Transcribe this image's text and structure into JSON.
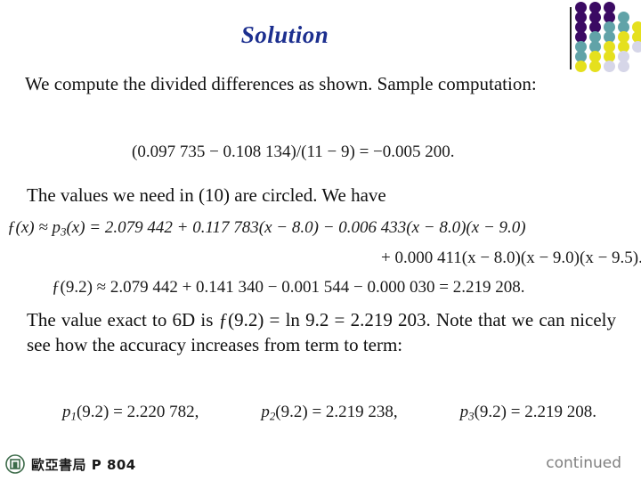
{
  "slide": {
    "title": "Solution",
    "title_color": "#1c2f8f"
  },
  "paragraphs": {
    "p1": "We compute the divided differences as shown. Sample computation:",
    "p2": "The values we need in (10) are circled. We have",
    "p3": "The value exact to 6D is ƒ(9.2) = ln 9.2 = 2.219 203. Note that we can nicely see how the accuracy increases from term to term:"
  },
  "equations": {
    "sample_computation": "(0.097 735 − 0.108 134)/(11 − 9) = −0.005 200.",
    "poly_line1_lhs": "ƒ(x) ≈ p",
    "poly_line1_sub": "3",
    "poly_line1_rhs": "(x) = 2.079 442 + 0.117 783(x − 8.0) − 0.006 433(x − 8.0)(x − 9.0)",
    "poly_line2": "+ 0.000 411(x − 8.0)(x − 9.0)(x − 9.5).",
    "evaluation": "ƒ(9.2) ≈ 2.079 442 + 0.141 340 − 0.001 544 − 0.000 030 = 2.219 208.",
    "terms": [
      {
        "symbol": "p",
        "sub": "1",
        "arg": "(9.2)",
        "rel": " = ",
        "value": "2.220 782,"
      },
      {
        "symbol": "p",
        "sub": "2",
        "arg": "(9.2)",
        "rel": " = ",
        "value": "2.219 238,"
      },
      {
        "symbol": "p",
        "sub": "3",
        "arg": "(9.2)",
        "rel": " = ",
        "value": "2.219 208."
      }
    ]
  },
  "footer": {
    "publisher": "歐亞書局 P 804",
    "continued": "continued",
    "continued_color": "#808080",
    "logo_color": "#3d6b4a"
  },
  "decoration": {
    "colors": {
      "purple": "#3b0a63",
      "teal": "#61a3a8",
      "yellow": "#e5e01e",
      "lavender": "#d6d6e8"
    },
    "dots": [
      {
        "row": 0,
        "col": 0,
        "color": "#3b0a63"
      },
      {
        "row": 0,
        "col": 1,
        "color": "#3b0a63"
      },
      {
        "row": 0,
        "col": 2,
        "color": "#3b0a63"
      },
      {
        "row": 1,
        "col": 0,
        "color": "#3b0a63"
      },
      {
        "row": 1,
        "col": 1,
        "color": "#3b0a63"
      },
      {
        "row": 1,
        "col": 2,
        "color": "#3b0a63"
      },
      {
        "row": 1,
        "col": 3,
        "color": "#61a3a8"
      },
      {
        "row": 2,
        "col": 0,
        "color": "#3b0a63"
      },
      {
        "row": 2,
        "col": 1,
        "color": "#3b0a63"
      },
      {
        "row": 2,
        "col": 2,
        "color": "#61a3a8"
      },
      {
        "row": 2,
        "col": 3,
        "color": "#61a3a8"
      },
      {
        "row": 2,
        "col": 4,
        "color": "#e5e01e"
      },
      {
        "row": 3,
        "col": 0,
        "color": "#3b0a63"
      },
      {
        "row": 3,
        "col": 1,
        "color": "#61a3a8"
      },
      {
        "row": 3,
        "col": 2,
        "color": "#61a3a8"
      },
      {
        "row": 3,
        "col": 3,
        "color": "#e5e01e"
      },
      {
        "row": 3,
        "col": 4,
        "color": "#e5e01e"
      },
      {
        "row": 4,
        "col": 0,
        "color": "#61a3a8"
      },
      {
        "row": 4,
        "col": 1,
        "color": "#61a3a8"
      },
      {
        "row": 4,
        "col": 2,
        "color": "#e5e01e"
      },
      {
        "row": 4,
        "col": 3,
        "color": "#e5e01e"
      },
      {
        "row": 4,
        "col": 4,
        "color": "#d6d6e8"
      },
      {
        "row": 5,
        "col": 0,
        "color": "#61a3a8"
      },
      {
        "row": 5,
        "col": 1,
        "color": "#e5e01e"
      },
      {
        "row": 5,
        "col": 2,
        "color": "#e5e01e"
      },
      {
        "row": 5,
        "col": 3,
        "color": "#d6d6e8"
      },
      {
        "row": 6,
        "col": 0,
        "color": "#e5e01e"
      },
      {
        "row": 6,
        "col": 1,
        "color": "#e5e01e"
      },
      {
        "row": 6,
        "col": 2,
        "color": "#d6d6e8"
      },
      {
        "row": 6,
        "col": 3,
        "color": "#d6d6e8"
      }
    ]
  }
}
